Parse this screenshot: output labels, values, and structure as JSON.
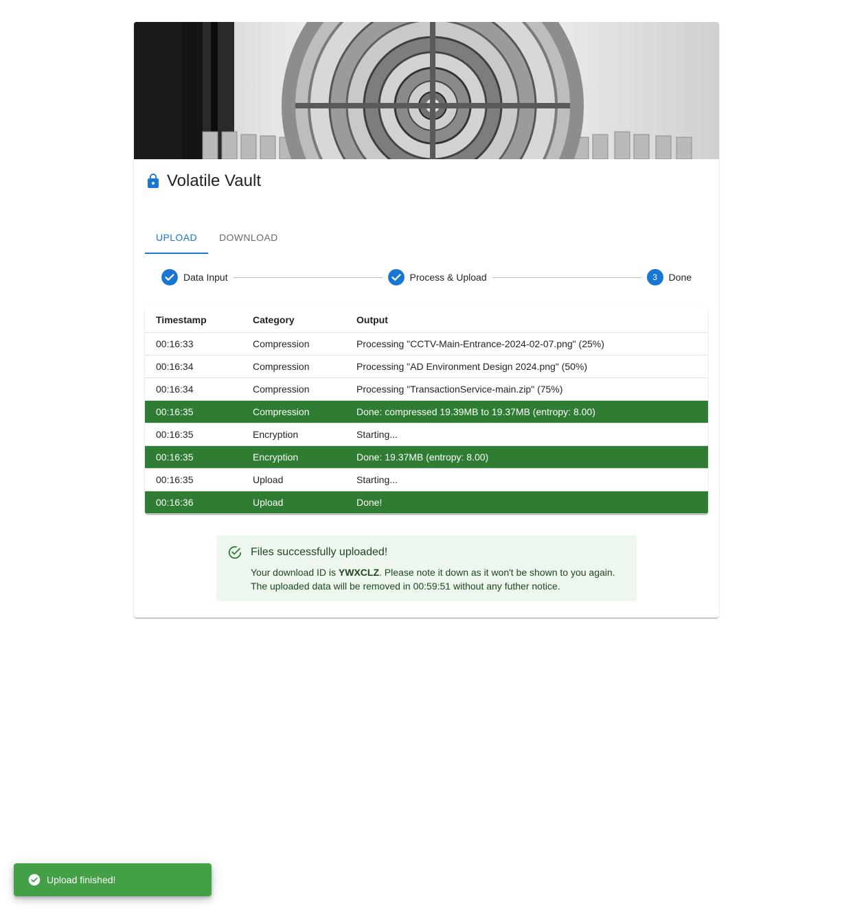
{
  "app": {
    "title": "Volatile Vault",
    "hero_image": "vault-door-image"
  },
  "tabs": [
    {
      "label": "UPLOAD",
      "active": true
    },
    {
      "label": "DOWNLOAD",
      "active": false
    }
  ],
  "stepper": {
    "steps": [
      {
        "label": "Data Input",
        "state": "completed"
      },
      {
        "label": "Process & Upload",
        "state": "completed"
      },
      {
        "label": "Done",
        "state": "active",
        "number": "3"
      }
    ]
  },
  "log_table": {
    "headers": [
      "Timestamp",
      "Category",
      "Output"
    ],
    "rows": [
      {
        "timestamp": "00:16:33",
        "category": "Compression",
        "output": "Processing \"CCTV-Main-Entrance-2024-02-07.png\" (25%)",
        "status": "info"
      },
      {
        "timestamp": "00:16:34",
        "category": "Compression",
        "output": "Processing \"AD Environment Design 2024.png\" (50%)",
        "status": "info"
      },
      {
        "timestamp": "00:16:34",
        "category": "Compression",
        "output": "Processing \"TransactionService-main.zip\" (75%)",
        "status": "info"
      },
      {
        "timestamp": "00:16:35",
        "category": "Compression",
        "output": "Done: compressed 19.39MB to 19.37MB (entropy: 8.00)",
        "status": "success"
      },
      {
        "timestamp": "00:16:35",
        "category": "Encryption",
        "output": "Starting...",
        "status": "info"
      },
      {
        "timestamp": "00:16:35",
        "category": "Encryption",
        "output": "Done: 19.37MB (entropy: 8.00)",
        "status": "success"
      },
      {
        "timestamp": "00:16:35",
        "category": "Upload",
        "output": "Starting...",
        "status": "info"
      },
      {
        "timestamp": "00:16:36",
        "category": "Upload",
        "output": "Done!",
        "status": "success"
      }
    ]
  },
  "success_alert": {
    "icon": "check-circle-icon",
    "title": "Files successfully uploaded!",
    "body_prefix": "Your download ID is ",
    "download_id": "YWXCLZ",
    "body_suffix": ". Please note it down as it won't be shown to you again.",
    "line2": "The uploaded data will be removed in 00:59:51 without any futher notice."
  },
  "snackbar": {
    "icon": "check-circle-icon",
    "message": "Upload finished!"
  },
  "colors": {
    "primary": "#1976d2",
    "success_row": "#2e7d32",
    "snackbar": "#43a047",
    "alert_bg": "#edf7ed",
    "alert_text": "#1e4620"
  }
}
